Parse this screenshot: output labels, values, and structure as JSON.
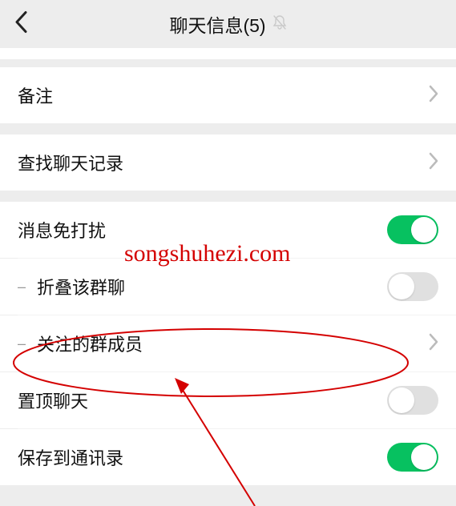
{
  "header": {
    "title": "聊天信息(5)"
  },
  "rows": {
    "remark": {
      "label": "备注"
    },
    "history": {
      "label": "查找聊天记录"
    },
    "dnd": {
      "label": "消息免打扰",
      "on": true
    },
    "collapse": {
      "label": "折叠该群聊",
      "on": false
    },
    "followed": {
      "label": "关注的群成员"
    },
    "pin": {
      "label": "置顶聊天",
      "on": false
    },
    "save": {
      "label": "保存到通讯录",
      "on": true
    }
  },
  "overlay": {
    "watermark": "songshuhezi.com"
  },
  "colors": {
    "accent": "#07c160",
    "annotation": "#d40000"
  }
}
